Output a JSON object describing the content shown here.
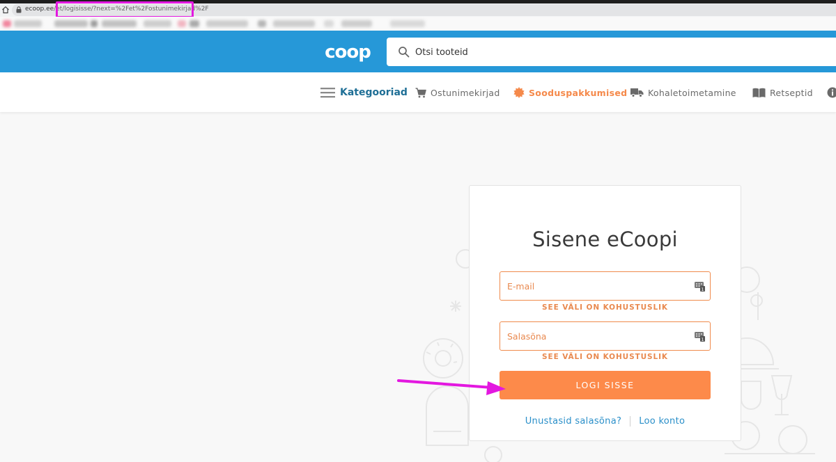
{
  "browser": {
    "url_domain": "ecoop.ee",
    "url_path": "/et/logisisse/?next=%2Fet%2Fostunimekirjad%2F"
  },
  "header": {
    "logo_text": "coop",
    "search_placeholder": "Otsi tooteid"
  },
  "nav": {
    "categories": "Kategooriad",
    "shopping_lists": "Ostunimekirjad",
    "offers": "Sooduspakkumised",
    "delivery": "Kohaletoimetamine",
    "recipes": "Retseptid"
  },
  "login": {
    "title": "Sisene eCoopi",
    "email_placeholder": "E-mail",
    "email_error": "SEE VÄLI ON KOHUSTUSLIK",
    "password_placeholder": "Salasõna",
    "password_error": "SEE VÄLI ON KOHUSTUSLIK",
    "submit_label": "LOGI SISSE",
    "forgot_link": "Unustasid salasõna?",
    "register_link": "Loo konto"
  },
  "colors": {
    "brand_blue": "#2698d8",
    "accent_orange": "#fd8a4a",
    "annotation_magenta": "#e318e0",
    "link_blue": "#2a8fc9"
  },
  "icons": [
    "home-icon",
    "lock-icon",
    "search-icon",
    "hamburger-icon",
    "cart-icon",
    "starburst-icon",
    "truck-icon",
    "book-icon",
    "info-icon",
    "keypad-icon"
  ]
}
